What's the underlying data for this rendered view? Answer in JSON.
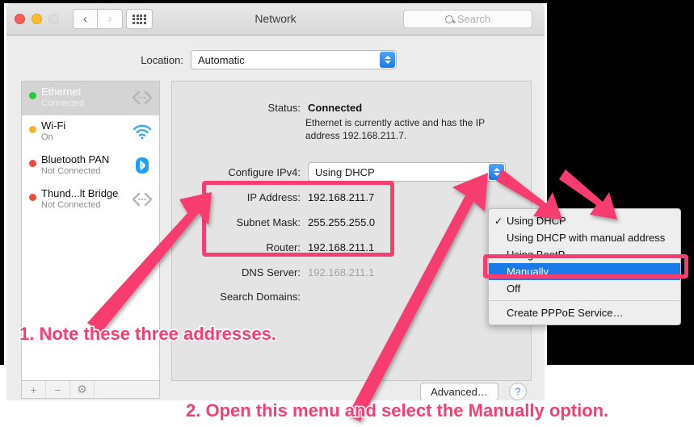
{
  "window": {
    "title": "Network",
    "traffic_lights": [
      "close",
      "minimize",
      "zoom"
    ],
    "nav_back": "‹",
    "nav_forward": "›",
    "grid_button": "show-all-icon"
  },
  "search": {
    "placeholder": "Search",
    "value": ""
  },
  "location": {
    "label": "Location:",
    "value": "Automatic"
  },
  "sidebar": {
    "items": [
      {
        "name": "Ethernet",
        "status": "Connected",
        "dot": "#27c840",
        "icon": "ethernet-icon",
        "selected": true
      },
      {
        "name": "Wi-Fi",
        "status": "On",
        "dot": "#f5b425",
        "icon": "wifi-icon",
        "selected": false
      },
      {
        "name": "Bluetooth PAN",
        "status": "Not Connected",
        "dot": "#f24b3e",
        "icon": "bluetooth-icon",
        "selected": false
      },
      {
        "name": "Thund...lt Bridge",
        "status": "Not Connected",
        "dot": "#f24b3e",
        "icon": "ethernet-icon",
        "selected": false
      }
    ],
    "footer": {
      "add": "+",
      "remove": "−",
      "actions": "⚙"
    }
  },
  "detail": {
    "status_label": "Status:",
    "status_value": "Connected",
    "status_description": "Ethernet is currently active and has the IP address 192.168.211.7.",
    "configure_label": "Configure IPv4:",
    "configure_value": "Using DHCP",
    "fields": [
      {
        "label": "IP Address:",
        "value": "192.168.211.7",
        "dim": false
      },
      {
        "label": "Subnet Mask:",
        "value": "255.255.255.0",
        "dim": false
      },
      {
        "label": "Router:",
        "value": "192.168.211.1",
        "dim": false
      },
      {
        "label": "DNS Server:",
        "value": "192.168.211.1",
        "dim": true
      },
      {
        "label": "Search Domains:",
        "value": "",
        "dim": false
      }
    ],
    "advanced_label": "Advanced…",
    "help_label": "?"
  },
  "menu": {
    "items": [
      {
        "label": "Using DHCP",
        "checked": true,
        "highlighted": false,
        "separator_after": false
      },
      {
        "label": "Using DHCP with manual address",
        "checked": false,
        "highlighted": false,
        "separator_after": false
      },
      {
        "label": "Using BootP",
        "checked": false,
        "highlighted": false,
        "separator_after": false
      },
      {
        "label": "Manually",
        "checked": false,
        "highlighted": true,
        "separator_after": false
      },
      {
        "label": "Off",
        "checked": false,
        "highlighted": false,
        "separator_after": true
      },
      {
        "label": "Create PPPoE Service…",
        "checked": false,
        "highlighted": false,
        "separator_after": false
      }
    ]
  },
  "annotations": {
    "accent_color": "#f73e70",
    "step1": "1. Note these three addresses.",
    "step2": "2. Open this menu and select the Manually option."
  }
}
